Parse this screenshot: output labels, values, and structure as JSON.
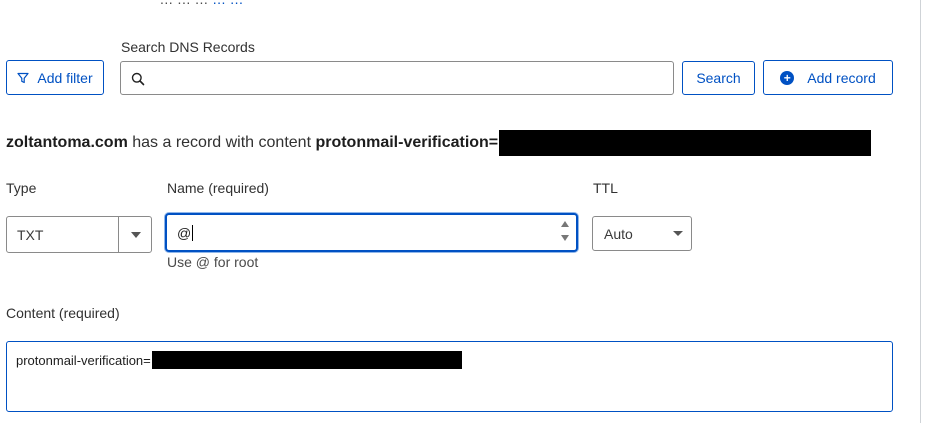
{
  "top_partial": {
    "text": "... ... ...",
    "link": "... ..."
  },
  "search": {
    "label": "Search DNS Records",
    "placeholder": "",
    "button": "Search"
  },
  "toolbar": {
    "add_filter": "Add filter",
    "add_record": "Add record"
  },
  "record_info": {
    "domain": "zoltantoma.com",
    "middle_text": " has a record with content ",
    "content_prefix": "protonmail-verification="
  },
  "form": {
    "type_label": "Type",
    "type_value": "TXT",
    "name_label": "Name (required)",
    "name_value": "@",
    "name_hint": "Use @ for root",
    "ttl_label": "TTL",
    "ttl_value": "Auto",
    "content_label": "Content (required)",
    "content_value": "protonmail-verification="
  },
  "colors": {
    "accent": "#0051c3",
    "text": "#313131",
    "border": "#8a8a8a"
  },
  "icons": {
    "filter": "filter-icon",
    "search": "search-icon",
    "add": "plus-circle-icon",
    "dropdown": "chevron-down-icon"
  }
}
